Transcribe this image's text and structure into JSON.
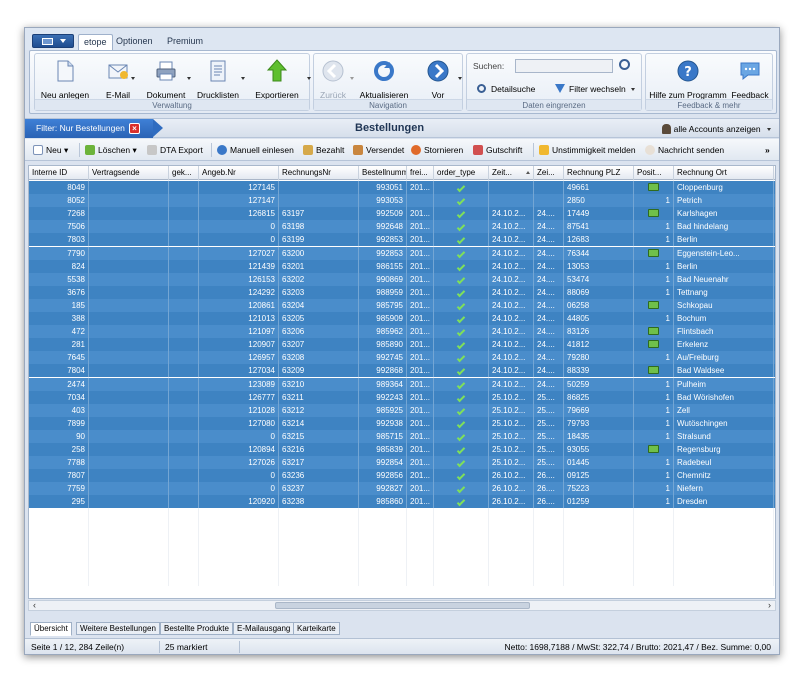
{
  "ribbon": {
    "tabs": [
      "etope",
      "Optionen",
      "Premium"
    ],
    "groups": {
      "verwaltung": {
        "title": "Verwaltung",
        "buttons": [
          "Neu anlegen",
          "E-Mail",
          "Dokument",
          "Drucklisten",
          "Exportieren"
        ]
      },
      "navigation": {
        "title": "Navigation",
        "buttons": [
          "Zurück",
          "Aktualisieren",
          "Vor"
        ]
      },
      "daten": {
        "title": "Daten eingrenzen",
        "search_label": "Suchen:",
        "search_value": "",
        "detailsuche": "Detailsuche",
        "filter": "Filter wechseln"
      },
      "hilfe": {
        "title": "Feedback & mehr",
        "hilfe": "Hilfe zum Programm",
        "feedback": "Feedback"
      }
    }
  },
  "filterbar": {
    "chip": "Filter: Nur Bestellungen",
    "title": "Bestellungen",
    "accounts": "alle Accounts anzeigen"
  },
  "toolbar": {
    "neu": "Neu",
    "loeschen": "Löschen",
    "dta": "DTA Export",
    "manuell": "Manuell einlesen",
    "bezahlt": "Bezahlt",
    "versendet": "Versendet",
    "stornieren": "Stornieren",
    "gutschrift": "Gutschrift",
    "unstimmigkeit": "Unstimmigkeit melden",
    "nachricht": "Nachricht senden"
  },
  "grid": {
    "columns": [
      "Interne ID",
      "Vertragsende",
      "gek...",
      "Angeb.Nr",
      "RechnungsNr",
      "Bestellnummer",
      "frei...",
      "order_type",
      "Zeit...",
      "Zei...",
      "Rechnung PLZ",
      "Posit...",
      "Rechnung Ort"
    ],
    "rows": [
      {
        "id": "8049",
        "angeb": "127145",
        "rnr": "",
        "best": "993051",
        "frei": "201...",
        "zeit": "",
        "zei": "",
        "plz": "49661",
        "pos": "icon",
        "ort": "Cloppenburg"
      },
      {
        "id": "8052",
        "angeb": "127147",
        "rnr": "",
        "best": "993053",
        "frei": "",
        "zeit": "",
        "zei": "",
        "plz": "2850",
        "pos": "1",
        "ort": "Petrich"
      },
      {
        "id": "7268",
        "angeb": "126815",
        "rnr": "63197",
        "best": "992509",
        "frei": "201...",
        "zeit": "24.10.2...",
        "zei": "24....",
        "plz": "17449",
        "pos": "icon",
        "ort": "Karlshagen"
      },
      {
        "id": "7506",
        "angeb": "0",
        "rnr": "63198",
        "best": "992648",
        "frei": "201...",
        "zeit": "24.10.2...",
        "zei": "24....",
        "plz": "87541",
        "pos": "1",
        "ort": "Bad hindelang"
      },
      {
        "id": "7803",
        "angeb": "0",
        "rnr": "63199",
        "best": "992853",
        "frei": "201...",
        "zeit": "24.10.2...",
        "zei": "24....",
        "plz": "12683",
        "pos": "1",
        "ort": "Berlin"
      },
      {
        "id": "7790",
        "angeb": "127027",
        "rnr": "63200",
        "best": "992853",
        "frei": "201...",
        "zeit": "24.10.2...",
        "zei": "24....",
        "plz": "76344",
        "pos": "icon",
        "ort": "Eggenstein-Leo..."
      },
      {
        "id": "824",
        "angeb": "121439",
        "rnr": "63201",
        "best": "986155",
        "frei": "201...",
        "zeit": "24.10.2...",
        "zei": "24....",
        "plz": "13053",
        "pos": "1",
        "ort": "Berlin"
      },
      {
        "id": "5538",
        "angeb": "126153",
        "rnr": "63202",
        "best": "990869",
        "frei": "201...",
        "zeit": "24.10.2...",
        "zei": "24....",
        "plz": "53474",
        "pos": "1",
        "ort": "Bad Neuenahr"
      },
      {
        "id": "3676",
        "angeb": "124292",
        "rnr": "63203",
        "best": "988959",
        "frei": "201...",
        "zeit": "24.10.2...",
        "zei": "24....",
        "plz": "88069",
        "pos": "1",
        "ort": "Tettnang"
      },
      {
        "id": "185",
        "angeb": "120861",
        "rnr": "63204",
        "best": "985795",
        "frei": "201...",
        "zeit": "24.10.2...",
        "zei": "24....",
        "plz": "06258",
        "pos": "icon",
        "ort": "Schkopau"
      },
      {
        "id": "388",
        "angeb": "121013",
        "rnr": "63205",
        "best": "985909",
        "frei": "201...",
        "zeit": "24.10.2...",
        "zei": "24....",
        "plz": "44805",
        "pos": "1",
        "ort": "Bochum"
      },
      {
        "id": "472",
        "angeb": "121097",
        "rnr": "63206",
        "best": "985962",
        "frei": "201...",
        "zeit": "24.10.2...",
        "zei": "24....",
        "plz": "83126",
        "pos": "icon",
        "ort": "Flintsbach"
      },
      {
        "id": "281",
        "angeb": "120907",
        "rnr": "63207",
        "best": "985890",
        "frei": "201...",
        "zeit": "24.10.2...",
        "zei": "24....",
        "plz": "41812",
        "pos": "icon",
        "ort": "Erkelenz"
      },
      {
        "id": "7645",
        "angeb": "126957",
        "rnr": "63208",
        "best": "992745",
        "frei": "201...",
        "zeit": "24.10.2...",
        "zei": "24....",
        "plz": "79280",
        "pos": "1",
        "ort": "Au/Freiburg"
      },
      {
        "id": "7804",
        "angeb": "127034",
        "rnr": "63209",
        "best": "992868",
        "frei": "201...",
        "zeit": "24.10.2...",
        "zei": "24....",
        "plz": "88339",
        "pos": "icon",
        "ort": "Bad Waldsee"
      },
      {
        "id": "2474",
        "angeb": "123089",
        "rnr": "63210",
        "best": "989364",
        "frei": "201...",
        "zeit": "24.10.2...",
        "zei": "24....",
        "plz": "50259",
        "pos": "1",
        "ort": "Pulheim"
      },
      {
        "id": "7034",
        "angeb": "126777",
        "rnr": "63211",
        "best": "992243",
        "frei": "201...",
        "zeit": "25.10.2...",
        "zei": "25....",
        "plz": "86825",
        "pos": "1",
        "ort": "Bad Wörishofen"
      },
      {
        "id": "403",
        "angeb": "121028",
        "rnr": "63212",
        "best": "985925",
        "frei": "201...",
        "zeit": "25.10.2...",
        "zei": "25....",
        "plz": "79669",
        "pos": "1",
        "ort": "Zell"
      },
      {
        "id": "7899",
        "angeb": "127080",
        "rnr": "63214",
        "best": "992938",
        "frei": "201...",
        "zeit": "25.10.2...",
        "zei": "25....",
        "plz": "79793",
        "pos": "1",
        "ort": "Wutöschingen"
      },
      {
        "id": "90",
        "angeb": "0",
        "rnr": "63215",
        "best": "985715",
        "frei": "201...",
        "zeit": "25.10.2...",
        "zei": "25....",
        "plz": "18435",
        "pos": "1",
        "ort": "Stralsund"
      },
      {
        "id": "258",
        "angeb": "120894",
        "rnr": "63216",
        "best": "985839",
        "frei": "201...",
        "zeit": "25.10.2...",
        "zei": "25....",
        "plz": "93055",
        "pos": "icon",
        "ort": "Regensburg"
      },
      {
        "id": "7788",
        "angeb": "127026",
        "rnr": "63217",
        "best": "992854",
        "frei": "201...",
        "zeit": "25.10.2...",
        "zei": "25....",
        "plz": "01445",
        "pos": "1",
        "ort": "Radebeul"
      },
      {
        "id": "7807",
        "angeb": "0",
        "rnr": "63236",
        "best": "992856",
        "frei": "201...",
        "zeit": "26.10.2...",
        "zei": "26....",
        "plz": "09125",
        "pos": "1",
        "ort": "Chemnitz"
      },
      {
        "id": "7759",
        "angeb": "0",
        "rnr": "63237",
        "best": "992827",
        "frei": "201...",
        "zeit": "26.10.2...",
        "zei": "26....",
        "plz": "75223",
        "pos": "1",
        "ort": "Niefern"
      },
      {
        "id": "295",
        "angeb": "120920",
        "rnr": "63238",
        "best": "985860",
        "frei": "201...",
        "zeit": "26.10.2...",
        "zei": "26....",
        "plz": "01259",
        "pos": "1",
        "ort": "Dresden"
      }
    ]
  },
  "bottom_tabs": [
    "Übersicht",
    "Weitere Bestellungen",
    "Bestellte Produkte",
    "E-Mailausgang",
    "Karteikarte"
  ],
  "status": {
    "page": "Seite 1 / 12, 284 Zeile(n)",
    "marked": "25 markiert",
    "totals": "Netto: 1698,7188 / MwSt: 322,74 / Brutto: 2021,47 / Bez. Summe: 0,00"
  },
  "colors": {
    "selection": "#3e83c2",
    "accent": "#2a63b5",
    "check": "#7fe05a"
  }
}
